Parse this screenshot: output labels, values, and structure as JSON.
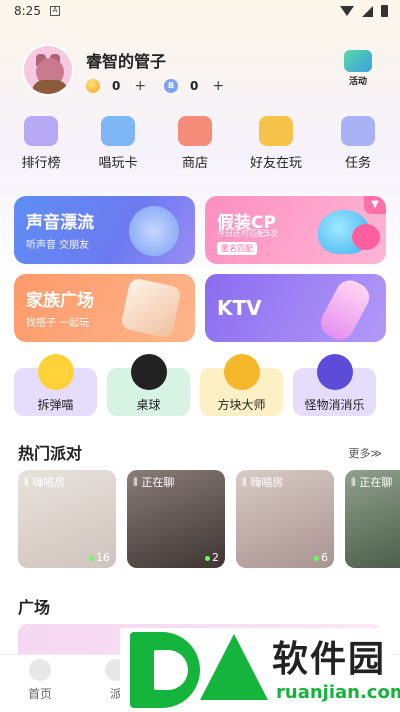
{
  "status_bar": {
    "time": "8:25",
    "notification_glyph": "A"
  },
  "profile": {
    "username": "睿智的管子",
    "gold_balance": "0",
    "diamond_balance": "0",
    "diamond_glyph": "B",
    "plus_label": "+",
    "activity_label": "活动"
  },
  "quick_nav": [
    {
      "label": "排行榜",
      "icon": "trophy-icon",
      "color": "#b8a9f5"
    },
    {
      "label": "唱玩卡",
      "icon": "card-icon",
      "color": "#7fb6f5"
    },
    {
      "label": "商店",
      "icon": "shop-icon",
      "color": "#f58c7a"
    },
    {
      "label": "好友在玩",
      "icon": "friends-icon",
      "color": "#f5c24a"
    },
    {
      "label": "任务",
      "icon": "task-icon",
      "color": "#a7b3f5"
    }
  ],
  "cards": {
    "voice": {
      "title": "声音漂流",
      "subtitle": "听声音 交朋友"
    },
    "cp": {
      "title": "假装CP",
      "subtitle": "今日还可匹配5次",
      "badge": "匿名匹配"
    },
    "family": {
      "title": "家族广场",
      "subtitle": "找搭子 一起玩"
    },
    "ktv": {
      "title": "KTV"
    }
  },
  "games": [
    {
      "label": "拆弹喵",
      "bg": "#e6dcfb",
      "icon_color": "#ffd23a"
    },
    {
      "label": "桌球",
      "bg": "#d7f3e4",
      "icon_color": "#222222"
    },
    {
      "label": "方块大师",
      "bg": "#fdf0c4",
      "icon_color": "#f5b82a"
    },
    {
      "label": "怪物消消乐",
      "bg": "#e6dcfb",
      "icon_color": "#5c4cd8"
    }
  ],
  "hot_party": {
    "title": "热门派对",
    "more_label": "更多≫",
    "rooms": [
      {
        "tag": "嗨唱房",
        "count": "16",
        "bg": "#d9d2cc"
      },
      {
        "tag": "正在聊",
        "count": "2",
        "bg": "#6b5e5a"
      },
      {
        "tag": "嗨唱房",
        "count": "6",
        "bg": "#c9b8b4"
      },
      {
        "tag": "正在聊",
        "count": "",
        "bg": "#6c7c6a"
      }
    ],
    "tag_prefix": "⦀"
  },
  "plaza": {
    "title": "广场"
  },
  "bottom_nav": [
    {
      "label": "首页"
    },
    {
      "label": "派"
    }
  ],
  "watermark": {
    "text": "软件园",
    "url": "ruanjian.com"
  },
  "colors": {
    "accent_green": "#15b43c",
    "pink": "#ff6fa8"
  }
}
